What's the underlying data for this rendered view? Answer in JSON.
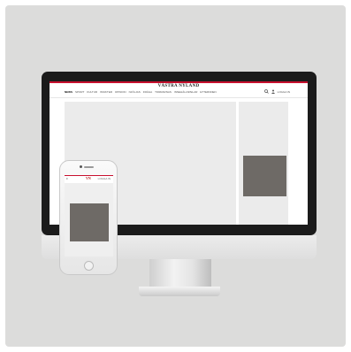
{
  "desktop": {
    "masthead": "VÄSTRA NYLAND",
    "nav_items": [
      "NEWS",
      "SPORT",
      "KULTUR",
      "INSIKTER",
      "OPINION",
      "NJÖLJAS",
      "FRÄGA",
      "TORRARNAS",
      "INNEHÅLLSPELAR",
      "ETTERNNEN"
    ],
    "search_icon": "search-icon",
    "login_label": "LOGGA IN"
  },
  "mobile": {
    "menu_icon": "menu-icon",
    "logo": "VN",
    "login_label": "LOGGA IN"
  },
  "colors": {
    "accent": "#c8102e",
    "ad_placeholder": "#6e6a66",
    "backdrop": "#dcdcdb"
  }
}
